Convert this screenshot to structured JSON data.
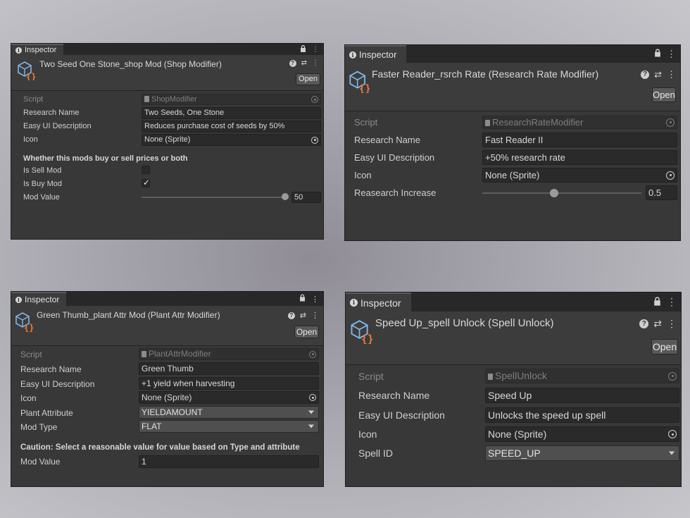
{
  "panels": [
    {
      "tab": "Inspector",
      "title": "Two Seed One Stone_shop Mod (Shop Modifier)",
      "open_label": "Open",
      "rows": {
        "script_label": "Script",
        "script_value": "ShopModifier",
        "research_name_label": "Research Name",
        "research_name_value": "Two Seeds, One Stone",
        "easy_ui_label": "Easy UI Description",
        "easy_ui_value": "Reduces purchase cost of seeds by 50%",
        "icon_label": "Icon",
        "icon_value": "None (Sprite)",
        "section_header": "Whether this mods buy or sell prices or both",
        "is_sell_label": "Is Sell Mod",
        "is_sell_checked": false,
        "is_buy_label": "Is Buy Mod",
        "is_buy_checked": true,
        "mod_value_label": "Mod Value",
        "mod_value": "50",
        "mod_value_fraction": 0.98
      }
    },
    {
      "tab": "Inspector",
      "title": "Faster Reader_rsrch Rate (Research Rate Modifier)",
      "open_label": "Open",
      "rows": {
        "script_label": "Script",
        "script_value": "ResearchRateModifier",
        "research_name_label": "Research Name",
        "research_name_value": "Fast Reader II",
        "easy_ui_label": "Easy UI Description",
        "easy_ui_value": "+50% research rate",
        "icon_label": "Icon",
        "icon_value": "None (Sprite)",
        "increase_label": "Reasearch Increase",
        "increase_value": "0.5",
        "increase_fraction": 0.45
      }
    },
    {
      "tab": "Inspector",
      "title": "Green Thumb_plant Attr Mod (Plant Attr Modifier)",
      "open_label": "Open",
      "rows": {
        "script_label": "Script",
        "script_value": "PlantAttrModifier",
        "research_name_label": "Research Name",
        "research_name_value": "Green Thumb",
        "easy_ui_label": "Easy UI Description",
        "easy_ui_value": "+1 yield when harvesting",
        "icon_label": "Icon",
        "icon_value": "None (Sprite)",
        "plant_attr_label": "Plant Attribute",
        "plant_attr_value": "YIELDAMOUNT",
        "mod_type_label": "Mod Type",
        "mod_type_value": "FLAT",
        "caution": "Caution: Select a reasonable value for value based on Type and attribute",
        "mod_value_label": "Mod Value",
        "mod_value": "1"
      }
    },
    {
      "tab": "Inspector",
      "title": "Speed Up_spell Unlock (Spell Unlock)",
      "open_label": "Open",
      "rows": {
        "script_label": "Script",
        "script_value": "SpellUnlock",
        "research_name_label": "Research Name",
        "research_name_value": "Speed Up",
        "easy_ui_label": "Easy UI Description",
        "easy_ui_value": "Unlocks the speed up spell",
        "icon_label": "Icon",
        "icon_value": "None (Sprite)",
        "spell_id_label": "Spell ID",
        "spell_id_value": "SPEED_UP"
      }
    }
  ],
  "icons": {
    "info": "info-icon",
    "lock": "lock-icon",
    "menu": "kebab-menu-icon",
    "help": "help-icon",
    "settings": "presets-icon",
    "component": "scriptable-object-icon",
    "object_picker": "object-picker-icon",
    "dropdown": "caret-down-icon"
  },
  "colors": {
    "panel_bg": "#383838",
    "field_bg": "#2a2a2a",
    "icon_blue": "#7fb6e6",
    "icon_orange": "#f07a3a"
  }
}
